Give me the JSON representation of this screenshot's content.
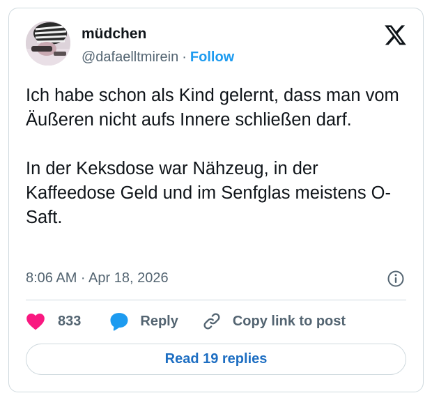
{
  "author": {
    "name": "müdchen",
    "handle": "@dafaelltmirein",
    "separator": "·",
    "follow_label": "Follow"
  },
  "tweet": {
    "text": "Ich habe schon als Kind gelernt, dass man vom Äußeren nicht aufs Innere schließen darf.\n\nIn der Keksdose war Nähzeug, in der Kaffeedose Geld und im Senfglas meistens O-Saft.",
    "timestamp": "8:06 AM · Apr 18, 2026"
  },
  "actions": {
    "like_count": "833",
    "reply_label": "Reply",
    "copy_link_label": "Copy link to post",
    "read_replies_label": "Read 19 replies"
  },
  "icons": {
    "brand": "x-logo-icon",
    "like": "heart-icon",
    "reply": "speech-bubble-icon",
    "copy": "link-icon",
    "info": "info-icon"
  },
  "colors": {
    "like": "#f91880",
    "reply": "#1d9bf0",
    "follow": "#1d9bf0",
    "read_replies": "#1d6ec2",
    "text_primary": "#0f1419",
    "text_secondary": "#536471",
    "border": "#cfd9de"
  }
}
